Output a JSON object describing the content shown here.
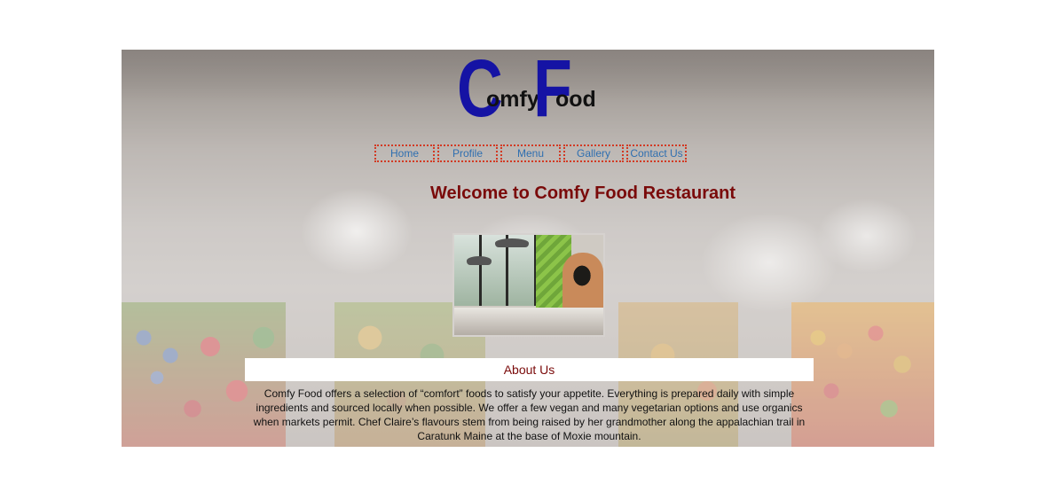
{
  "logo": {
    "big_c": "C",
    "small_1": "omfy",
    "big_f": "F",
    "small_2": "ood",
    "colors": {
      "initials": "#1513a4",
      "text": "#111111"
    }
  },
  "nav": {
    "items": [
      {
        "label": "Home"
      },
      {
        "label": "Profile"
      },
      {
        "label": "Menu"
      },
      {
        "label": "Gallery"
      },
      {
        "label": "Contact Us"
      }
    ],
    "colors": {
      "link": "#2f6fb0",
      "border": "#d23a24"
    }
  },
  "main": {
    "welcome_heading": "Welcome to Comfy Food Restaurant",
    "about_heading": "About Us",
    "about_text": "Comfy Food offers a selection of “comfort” foods to satisfy your appetite. Everything is prepared daily with simple ingredients and sourced locally when possible. We offer a few vegan and many vegetarian options and use organics when markets permit. Chef Claire’s flavours stem from being raised by her grandmother along the appalachian trail in Caratunk Maine at the base of Moxie mountain.",
    "colors": {
      "heading": "#7a0a0a"
    }
  }
}
